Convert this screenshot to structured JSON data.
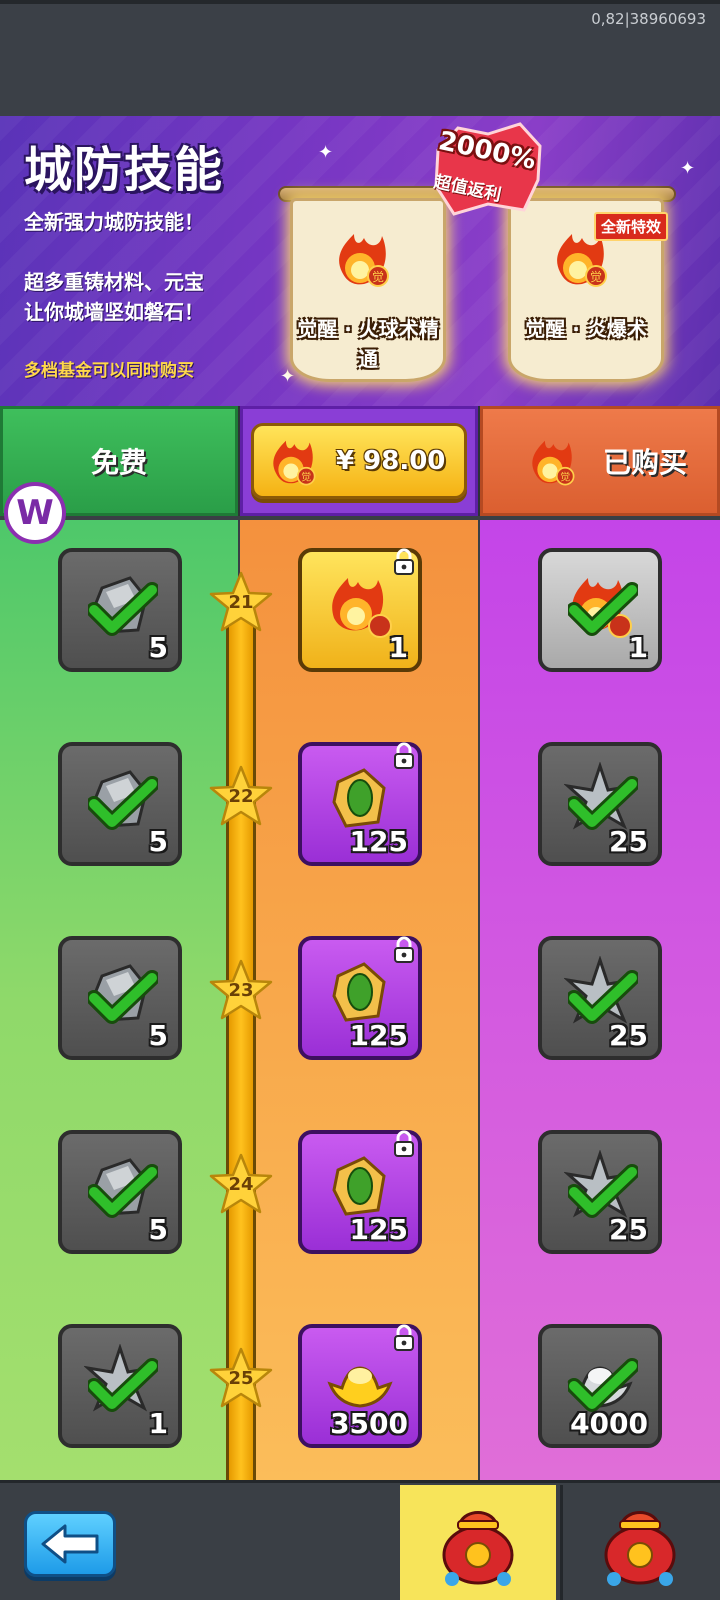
{
  "status": {
    "version_text": "0,82|38960693"
  },
  "banner": {
    "title": "城防技能",
    "line1": "全新强力城防技能！",
    "line2": "超多重铸材料、元宝",
    "line3": "让你城墙坚如磐石！",
    "note": "多档基金可以同时购买",
    "badge_percent": "2000%",
    "badge_text": "超值返利",
    "new_effect_tag": "全新特效",
    "skill1_name_a": "觉醒 · 火球术精",
    "skill1_name_b": "通",
    "skill2_name": "觉醒 · 炎爆术"
  },
  "tabs": {
    "free_label": "免费",
    "price_label": "¥ 98.00",
    "bought_label": "已购买"
  },
  "watermark": {
    "letter": "W"
  },
  "rows": [
    {
      "level": "21",
      "free_qty": "5",
      "pay_qty": "1",
      "bought_qty": "1"
    },
    {
      "level": "22",
      "free_qty": "5",
      "pay_qty": "125",
      "bought_qty": "25"
    },
    {
      "level": "23",
      "free_qty": "5",
      "pay_qty": "125",
      "bought_qty": "25"
    },
    {
      "level": "24",
      "free_qty": "5",
      "pay_qty": "125",
      "bought_qty": "25"
    },
    {
      "level": "25",
      "free_qty": "1",
      "pay_qty": "3500",
      "bought_qty": "4000"
    }
  ],
  "icons": {
    "free_items": [
      "stone-icon",
      "stone-icon",
      "stone-icon",
      "stone-icon",
      "shuriken-icon"
    ],
    "pay_items": [
      "fireball-icon",
      "gem-icon",
      "gem-icon",
      "gem-icon",
      "gold-ingot-icon"
    ],
    "bought_items": [
      "fireball-icon",
      "shuriken-icon",
      "shuriken-icon",
      "shuriken-icon",
      "silver-ingot-icon"
    ]
  },
  "colors": {
    "free_column": "#8fd96a",
    "pay_column": "#f8a84b",
    "bought_column": "#d35ae0",
    "accent_gold": "#f5b214",
    "check_green": "#2fbf2a"
  }
}
